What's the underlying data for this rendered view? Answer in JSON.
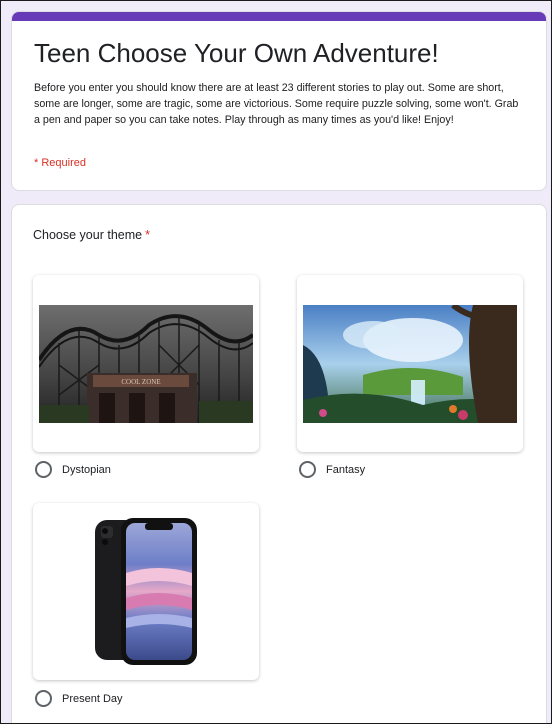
{
  "form": {
    "title": "Teen Choose Your Own Adventure!",
    "description": "Before you enter you should know there are at least 23 different stories to play out. Some are short, some are longer, some are tragic, some are victorious. Some require puzzle solving, some won't. Grab a pen and paper so you can take notes. Play through as many times as you'd like! Enjoy!",
    "required_note": "* Required",
    "accent_color": "#673ab7",
    "background_color": "#f0ebf8"
  },
  "question": {
    "title": "Choose your theme",
    "required_mark": "*",
    "options": [
      {
        "label": "Dystopian",
        "image": "abandoned-rollercoaster-image",
        "sign_text": "COOL ZONE"
      },
      {
        "label": "Fantasy",
        "image": "fantasy-landscape-image"
      },
      {
        "label": "Present Day",
        "image": "smartphone-image"
      }
    ]
  }
}
